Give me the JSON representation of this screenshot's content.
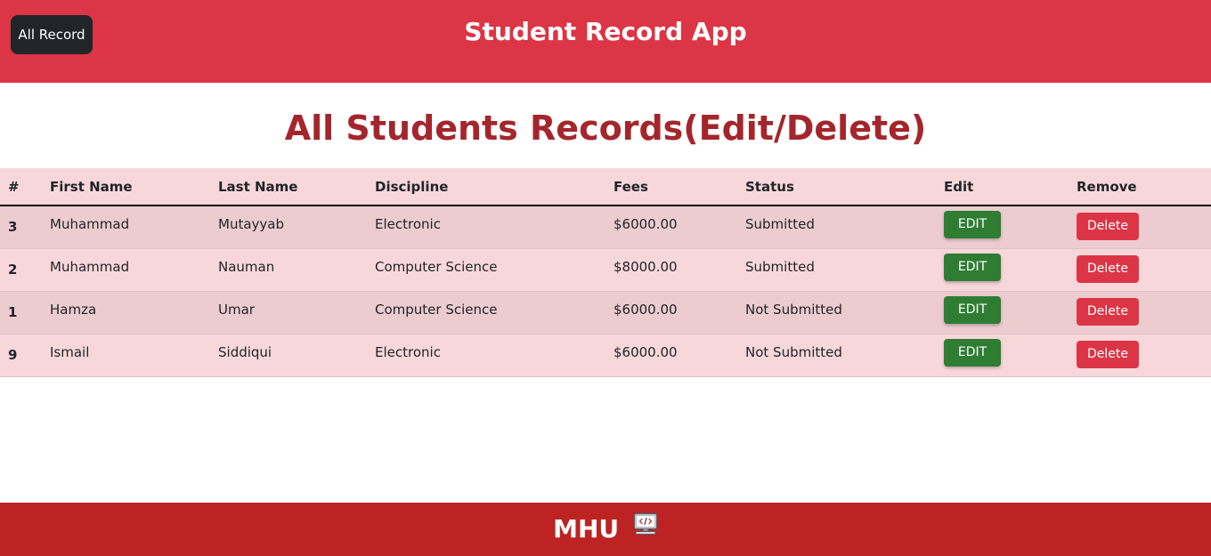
{
  "header": {
    "nav_button_label": "All Record",
    "app_title": "Student Record App"
  },
  "main": {
    "page_title": "All Students Records(Edit/Delete)"
  },
  "table": {
    "columns": [
      "#",
      "First Name",
      "Last Name",
      "Discipline",
      "Fees",
      "Status",
      "Edit",
      "Remove"
    ],
    "rows": [
      {
        "id": "3",
        "first_name": "Muhammad",
        "last_name": "Mutayyab",
        "discipline": "Electronic",
        "fees": "$6000.00",
        "status": "Submitted",
        "edit_label": "EDIT",
        "delete_label": "Delete"
      },
      {
        "id": "2",
        "first_name": "Muhammad",
        "last_name": "Nauman",
        "discipline": "Computer Science",
        "fees": "$8000.00",
        "status": "Submitted",
        "edit_label": "EDIT",
        "delete_label": "Delete"
      },
      {
        "id": "1",
        "first_name": "Hamza",
        "last_name": "Umar",
        "discipline": "Computer Science",
        "fees": "$6000.00",
        "status": "Not Submitted",
        "edit_label": "EDIT",
        "delete_label": "Delete"
      },
      {
        "id": "9",
        "first_name": "Ismail",
        "last_name": "Siddiqui",
        "discipline": "Electronic",
        "fees": "$6000.00",
        "status": "Not Submitted",
        "edit_label": "EDIT",
        "delete_label": "Delete"
      }
    ]
  },
  "footer": {
    "brand": "MHU",
    "icon": "computer-code-icon"
  },
  "colors": {
    "header_bg": "#dc3545",
    "nav_button_bg": "#212529",
    "page_title": "#a4262c",
    "table_header_bg": "#f8d7da",
    "row_odd_bg": "#eccccf",
    "edit_button_bg": "#2e7d32",
    "delete_button_bg": "#dc3545",
    "footer_bg": "#bd2323"
  }
}
